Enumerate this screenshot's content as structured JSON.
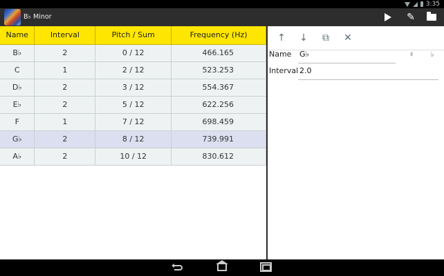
{
  "status_bar": {
    "time": "3:35"
  },
  "action_bar": {
    "title": "B♭ Minor",
    "play_icon": "play-icon",
    "edit_icon": "pencil-icon",
    "folder_icon": "folder-icon"
  },
  "table": {
    "headers": [
      "Name",
      "Interval",
      "Pitch / Sum",
      "Frequency (Hz)"
    ],
    "rows": [
      {
        "name": "B♭",
        "interval": "2",
        "pitch": "0 / 12",
        "freq": "466.165"
      },
      {
        "name": "C",
        "interval": "1",
        "pitch": "2 / 12",
        "freq": "523.253"
      },
      {
        "name": "D♭",
        "interval": "2",
        "pitch": "3 / 12",
        "freq": "554.367"
      },
      {
        "name": "E♭",
        "interval": "2",
        "pitch": "5 / 12",
        "freq": "622.256"
      },
      {
        "name": "F",
        "interval": "1",
        "pitch": "7 / 12",
        "freq": "698.459"
      },
      {
        "name": "G♭",
        "interval": "2",
        "pitch": "8 / 12",
        "freq": "739.991"
      },
      {
        "name": "A♭",
        "interval": "2",
        "pitch": "10 / 12",
        "freq": "830.612"
      }
    ],
    "selected_index": 5
  },
  "detail": {
    "toolbar_icons": [
      "arrow-up-icon",
      "arrow-down-icon",
      "copy-icon",
      "close-icon"
    ],
    "name_label": "Name",
    "name_value": "G♭",
    "sharp_symbol": "♯",
    "flat_symbol": "♭",
    "interval_label": "Interval",
    "interval_value": "2.0"
  },
  "colors": {
    "header_bg": "#ffe600",
    "row_bg": "#eef2f2",
    "selected_row_bg": "#dcdff0",
    "action_bar": "#2d2d2d"
  }
}
